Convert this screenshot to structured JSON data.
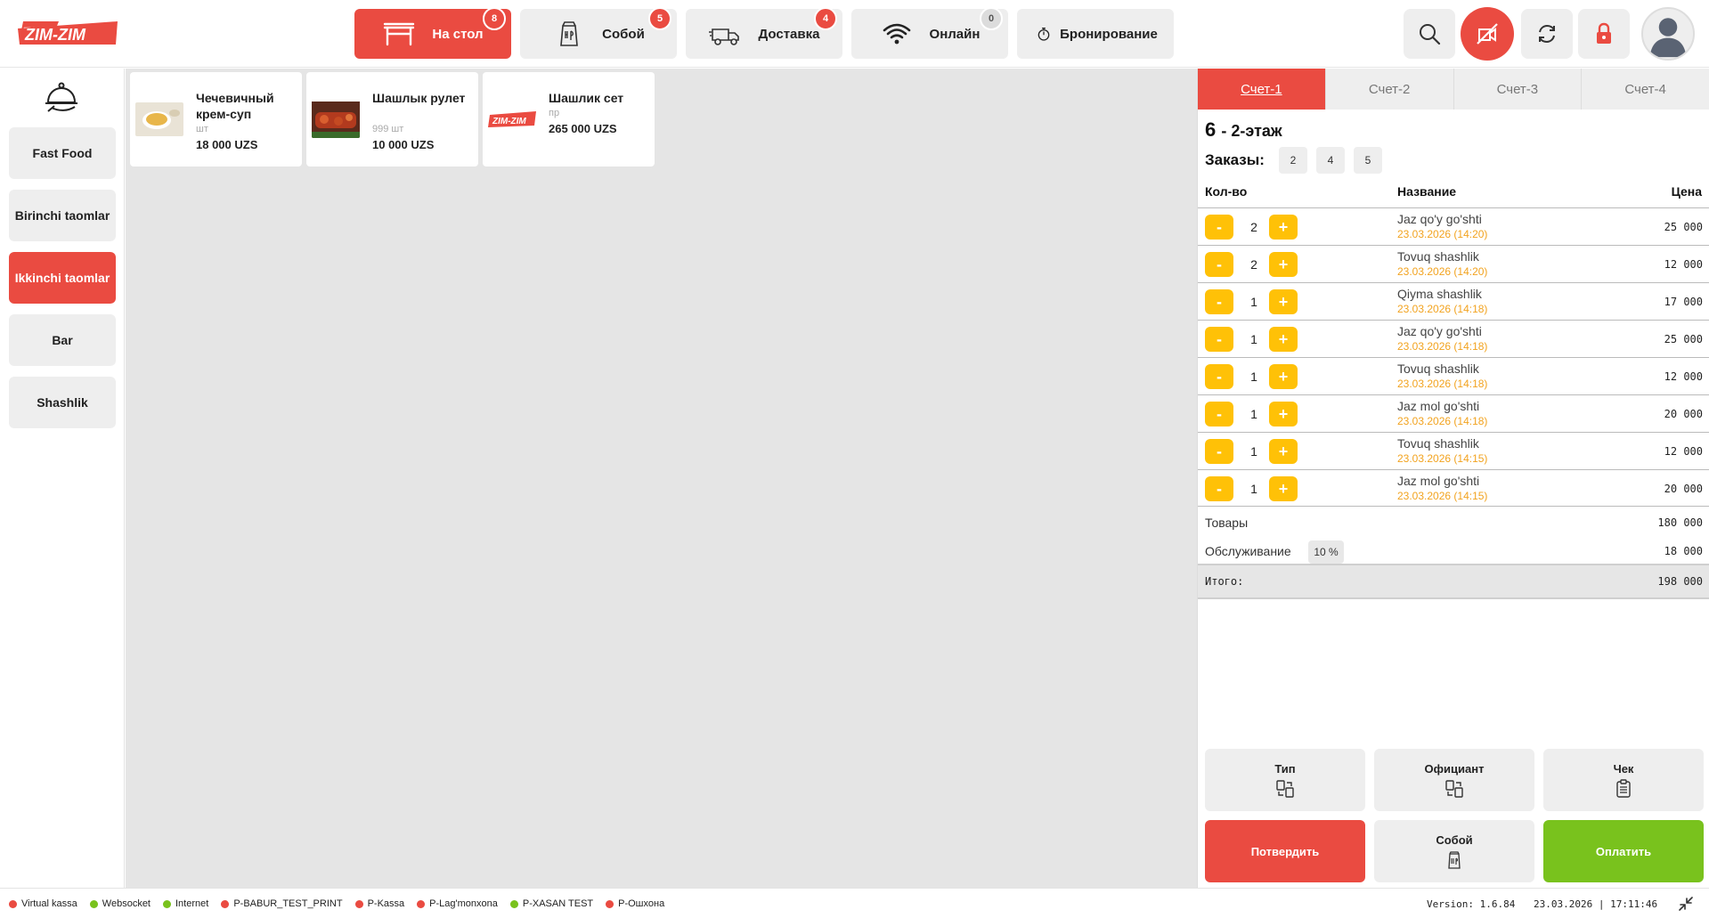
{
  "brand": {
    "logo_text": "ZIM-ZIM",
    "accent": "#ea4b41",
    "yellow": "#ffc107",
    "green": "#79c21d"
  },
  "nav": [
    {
      "label": "На стол",
      "badge": "8",
      "icon": "table-icon",
      "active": true
    },
    {
      "label": "Собой",
      "badge": "5",
      "icon": "takeaway-bag-icon",
      "active": false
    },
    {
      "label": "Доставка",
      "badge": "4",
      "icon": "delivery-truck-icon",
      "active": false
    },
    {
      "label": "Онлайн",
      "badge": "0",
      "icon": "wifi-icon",
      "active": false
    },
    {
      "label": "Бронирование",
      "badge": "",
      "icon": "timer-icon",
      "active": false
    }
  ],
  "toolbar": {
    "icons": [
      "search-icon",
      "no-camera-icon",
      "refresh-icon",
      "lock-icon",
      "user-avatar-icon"
    ]
  },
  "categories": [
    {
      "label": "Fast Food",
      "active": false
    },
    {
      "label": "Birinchi taomlar",
      "active": false
    },
    {
      "label": "Ikkinchi taomlar",
      "active": true
    },
    {
      "label": "Bar",
      "active": false
    },
    {
      "label": "Shashlik",
      "active": false
    }
  ],
  "products": [
    {
      "name": "Чечевичный крем-суп",
      "unit": "шт",
      "price": "18 000 UZS"
    },
    {
      "name": "Шашлык рулет",
      "unit": "999 шт",
      "price": "10 000 UZS"
    },
    {
      "name": "Шашлик сет",
      "unit": "пр",
      "price": "265 000 UZS"
    }
  ],
  "bill_tabs": [
    {
      "label": "Счет-1",
      "active": true
    },
    {
      "label": "Счет-2",
      "active": false
    },
    {
      "label": "Счет-3",
      "active": false
    },
    {
      "label": "Счет-4",
      "active": false
    }
  ],
  "order": {
    "table_number": "6",
    "table_location": "- 2-этаж",
    "orders_label": "Заказы:",
    "order_ids": [
      "2",
      "4",
      "5"
    ],
    "headers": {
      "qty": "Кол-во",
      "name": "Название",
      "price": "Цена"
    },
    "items": [
      {
        "qty": "2",
        "name": "Jaz qo'y go'shti",
        "time": "23.03.2026 (14:20)",
        "price": "25 000"
      },
      {
        "qty": "2",
        "name": "Tovuq shashlik",
        "time": "23.03.2026 (14:20)",
        "price": "12 000"
      },
      {
        "qty": "1",
        "name": "Qiyma shashlik",
        "time": "23.03.2026 (14:18)",
        "price": "17 000"
      },
      {
        "qty": "1",
        "name": "Jaz qo'y go'shti",
        "time": "23.03.2026 (14:18)",
        "price": "25 000"
      },
      {
        "qty": "1",
        "name": "Tovuq shashlik",
        "time": "23.03.2026 (14:18)",
        "price": "12 000"
      },
      {
        "qty": "1",
        "name": "Jaz mol go'shti",
        "time": "23.03.2026 (14:18)",
        "price": "20 000"
      },
      {
        "qty": "1",
        "name": "Tovuq shashlik",
        "time": "23.03.2026 (14:15)",
        "price": "12 000"
      },
      {
        "qty": "1",
        "name": "Jaz mol go'shti",
        "time": "23.03.2026 (14:15)",
        "price": "20 000"
      }
    ],
    "goods_label": "Товары",
    "goods_value": "180 000",
    "service_label": "Обслуживание",
    "service_percent": "10 %",
    "service_value": "18 000",
    "total_label": "Итого:",
    "total_value": "198 000"
  },
  "actions": {
    "type": "Тип",
    "waiter": "Официант",
    "check": "Чек",
    "confirm": "Потвердить",
    "takeaway": "Собой",
    "pay": "Оплатить"
  },
  "status": [
    {
      "label": "Virtual kassa",
      "color": "#ea4b41"
    },
    {
      "label": "Websocket",
      "color": "#79c21d"
    },
    {
      "label": "Internet",
      "color": "#79c21d"
    },
    {
      "label": "P-BABUR_TEST_PRINT",
      "color": "#ea4b41"
    },
    {
      "label": "P-Kassa",
      "color": "#ea4b41"
    },
    {
      "label": "P-Lag'monxona",
      "color": "#ea4b41"
    },
    {
      "label": "P-XASAN TEST",
      "color": "#79c21d"
    },
    {
      "label": "P-Ошхона",
      "color": "#ea4b41"
    }
  ],
  "footer": {
    "version": "Version: 1.6.84",
    "datetime": "23.03.2026 | 17:11:46"
  }
}
